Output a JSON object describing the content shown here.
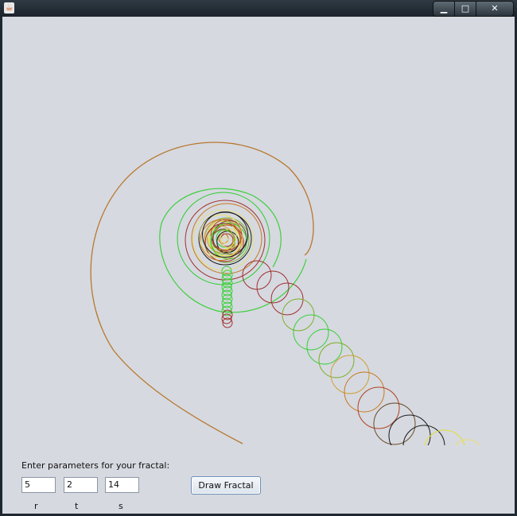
{
  "window": {
    "title": "",
    "controls": {
      "minimize_glyph": "▁",
      "maximize_glyph": "□",
      "close_glyph": "✕"
    }
  },
  "form": {
    "prompt": "Enter parameters for your fractal:",
    "fields": [
      {
        "value": "5",
        "label": "r"
      },
      {
        "value": "2",
        "label": "t"
      },
      {
        "value": "14",
        "label": "s"
      }
    ],
    "draw_button": "Draw Fractal"
  },
  "colors": {
    "background": "#d6d9e0",
    "palette": [
      "#2ecc2e",
      "#a03030",
      "#c8781e",
      "#e8e070",
      "#1a1a1a",
      "#7db02a",
      "#d0a030",
      "#e0e030",
      "#b04020",
      "#6b4a2a"
    ]
  }
}
